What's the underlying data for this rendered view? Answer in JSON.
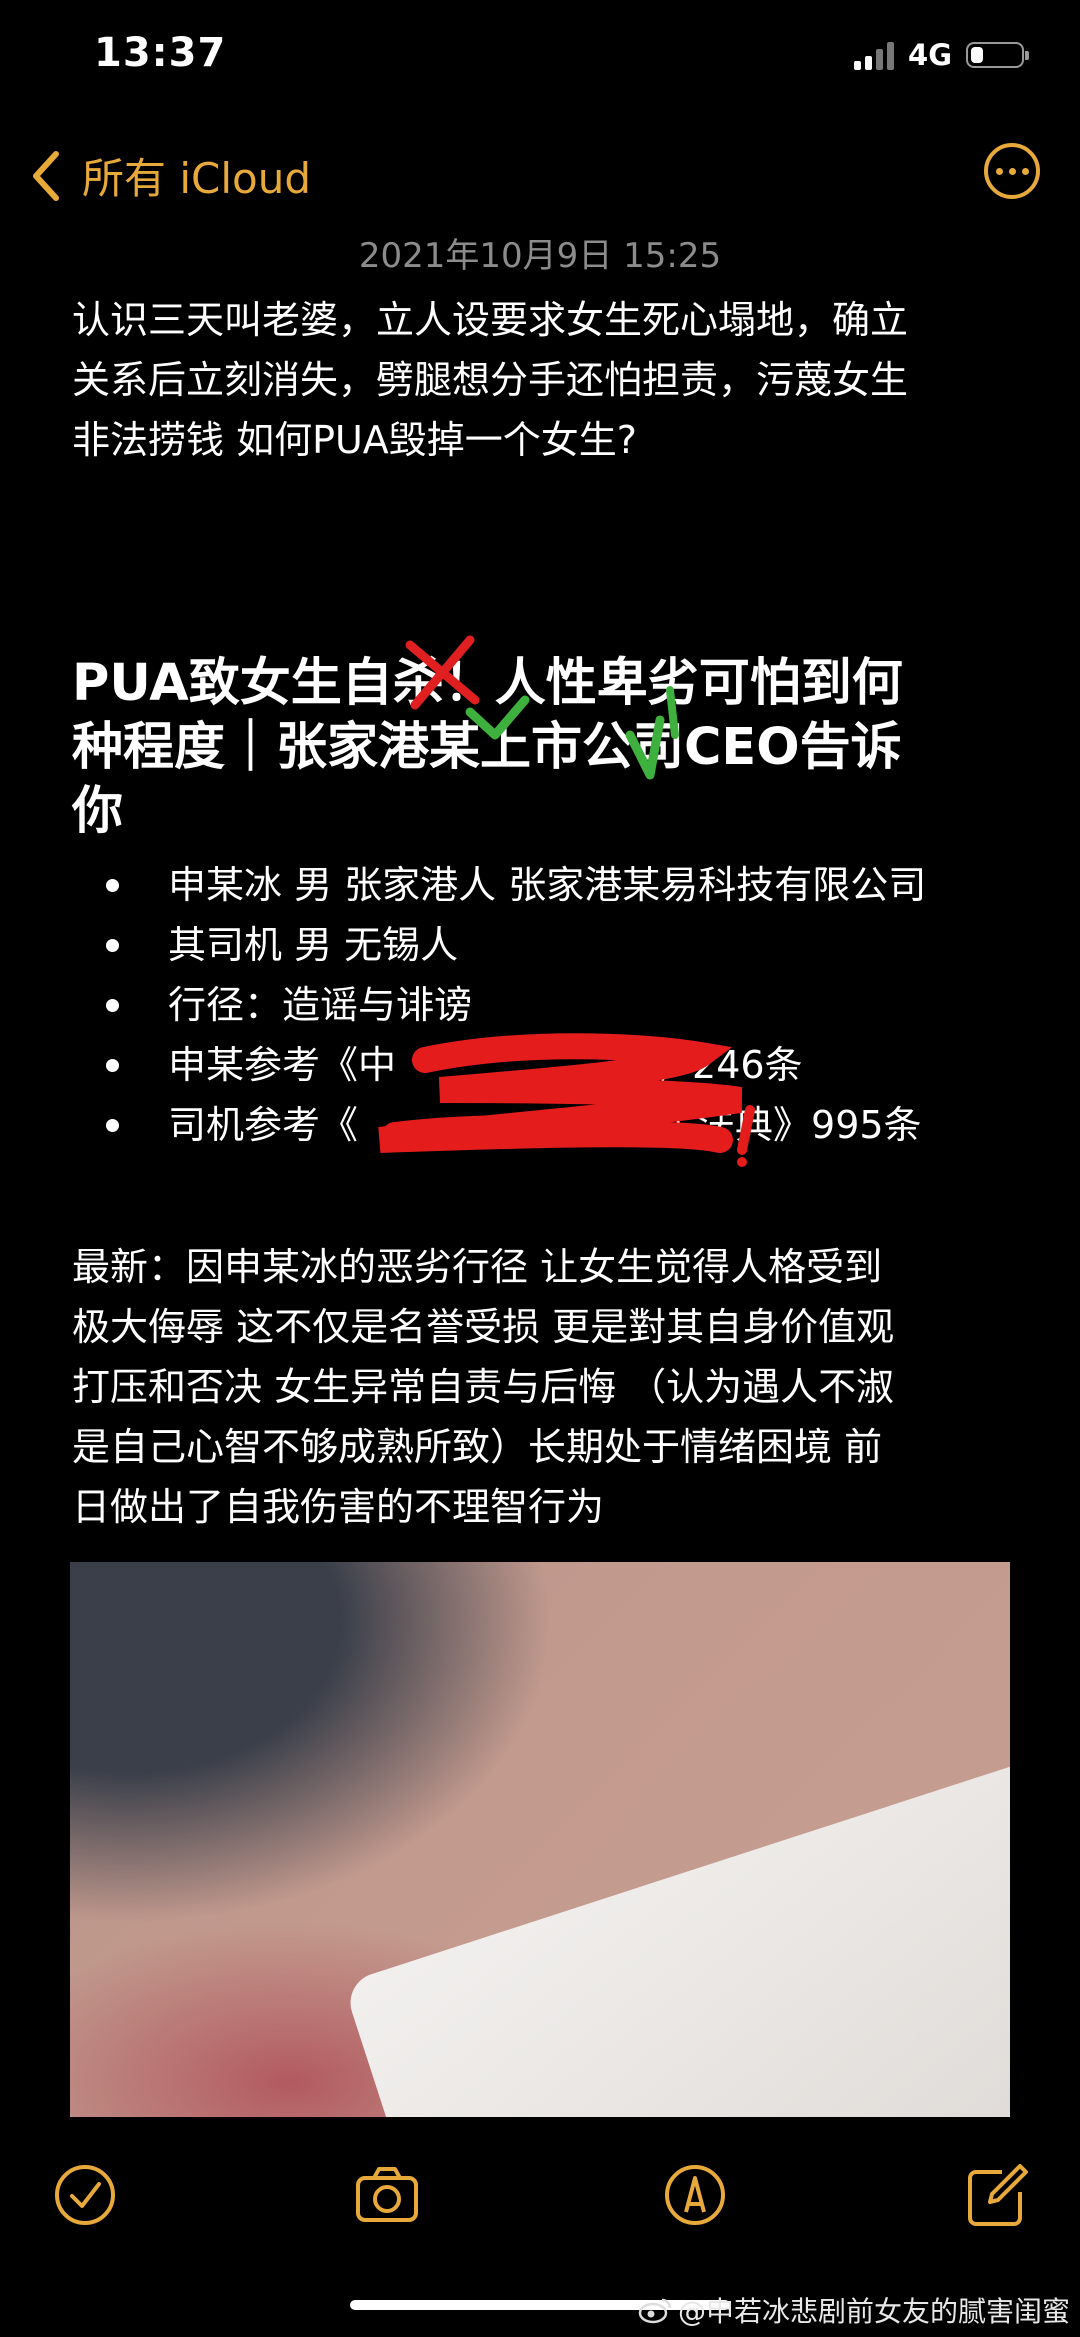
{
  "status_bar": {
    "time": "13:37",
    "network": "4G",
    "battery_level": 0.25
  },
  "nav": {
    "back_label": "所有 iCloud"
  },
  "note": {
    "date": "2021年10月9日 15:25",
    "intro_lines": [
      "认识三天叫老婆，立人设要求女生死心塌地，确立",
      "关系后立刻消失，劈腿想分手还怕担责，污蔑女生",
      "非法捞钱 如何PUA毁掉一个女生?"
    ],
    "heading_lines": [
      "PUA致女生自杀！人性卑劣可怕到何",
      "种程度｜张家港某上市公司CEO告诉",
      "你"
    ],
    "bullets": [
      "申某冰 男 张家港人 张家港某易科技有限公司",
      " 其司机 男 无锡人",
      "行径：造谣与诽谤",
      " 申某参考《中",
      " 司机参考《"
    ],
    "bullet_tails": [
      "",
      "",
      "",
      "法》246条",
      "和国民法典》995条"
    ],
    "latest_lines": [
      "最新：因申某冰的恶劣行径 让女生觉得人格受到",
      "极大侮辱 这不仅是名誉受损 更是對其自身价值观",
      "打压和否决 女生异常自责与后悔 （认为遇人不淑",
      "是自己心智不够成熟所致）长期处于情绪困境 前",
      "日做出了自我伤害的不理智行为"
    ]
  },
  "toolbar": {
    "icons": [
      "checkmark-circle-icon",
      "camera-icon",
      "markup-pen-icon",
      "compose-icon"
    ],
    "accent_color": "#e7a93a"
  },
  "watermark": {
    "text": "@申若冰悲剧前女友的腻害闺蜜"
  }
}
